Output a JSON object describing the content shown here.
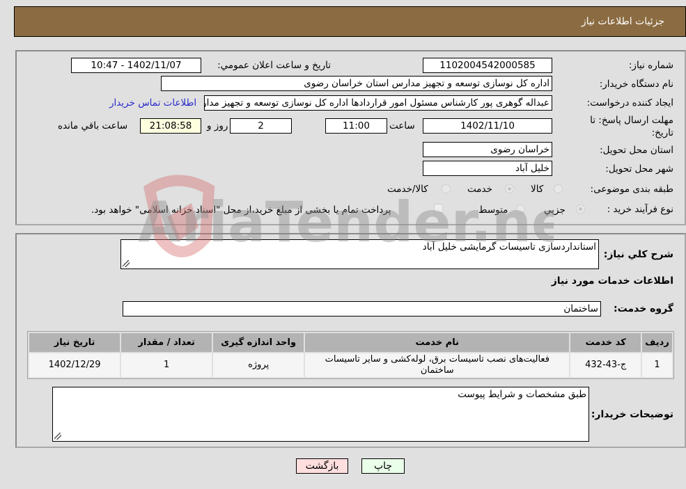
{
  "header": {
    "title": "جزئیات اطلاعات نیاز"
  },
  "details": {
    "need_number": {
      "label": "شماره نیاز:",
      "value": "1102004542000585"
    },
    "announce_datetime": {
      "label": "تاریخ و ساعت اعلان عمومي:",
      "value": "1402/11/07 - 10:47"
    },
    "buyer_org": {
      "label": "نام دستگاه خریدار:",
      "value": "اداره کل نوسازی  توسعه و تجهیز مدارس استان خراسان رضوی"
    },
    "requester": {
      "label": "ایجاد کننده درخواست:",
      "value": "عبداله گوهری پور کارشناس مسئول امور قراردادها  اداره کل نوسازی  توسعه و تجهیز مدارس استان خراسان رضوی"
    },
    "buyer_contact_link": "اطلاعات تماس خریدار",
    "deadline": {
      "label": "مهلت ارسال پاسخ: تا تاریخ:",
      "date": "1402/11/10",
      "time_label": "ساعت",
      "time": "11:00",
      "days": "2",
      "days_label": "روز و",
      "remaining": "21:08:58",
      "remaining_label": "ساعت باقي مانده"
    },
    "delivery_province": {
      "label": "استان محل تحویل:",
      "value": "خراسان رضوی"
    },
    "delivery_city": {
      "label": "شهر محل تحویل:",
      "value": "خلیل آباد"
    },
    "category": {
      "label": "طبقه بندی موضوعی:",
      "options": [
        "کالا",
        "خدمت",
        "کالا/خدمت"
      ],
      "selected": "خدمت"
    },
    "purchase_process": {
      "label": "نوع فرآیند خرید :",
      "options": [
        "جزيي",
        "متوسط"
      ],
      "selected": "جزيي",
      "treasury_note": "پرداخت تمام یا بخشی از مبلغ خرید،از محل \"اسناد خزانه اسلامی\" خواهد بود.",
      "treasury_checked": false
    }
  },
  "description": {
    "label": "شرح کلي نیاز:",
    "value": "استانداردسازی تاسیسات گرمایشی خلیل آباد"
  },
  "services_section_title": "اطلاعات خدمات مورد نیاز",
  "service_group": {
    "label": "گروه خدمت:",
    "value": "ساختمان"
  },
  "services_table": {
    "headers": [
      "ردیف",
      "کد خدمت",
      "نام خدمت",
      "واحد اندازه گیری",
      "تعداد / مقدار",
      "تاریخ نیاز"
    ],
    "rows": [
      [
        "1",
        "ج-43-432",
        "فعالیت‌های نصب تاسیسات برق، لوله‌کشی و سایر تاسیسات ساختمان",
        "پروژه",
        "1",
        "1402/12/29"
      ]
    ]
  },
  "buyer_notes": {
    "label": "توضیحات خریدار:",
    "value": "طبق مشخصات و شرایط پیوست"
  },
  "buttons": {
    "print": "چاپ",
    "back": "بازگشت"
  },
  "watermark": {
    "text": "AriaTender.neT"
  },
  "colors": {
    "header_bg": "#8b6c42",
    "link": "#2a2acc",
    "print_bg": "#eaffea",
    "back_bg": "#ffdede"
  }
}
